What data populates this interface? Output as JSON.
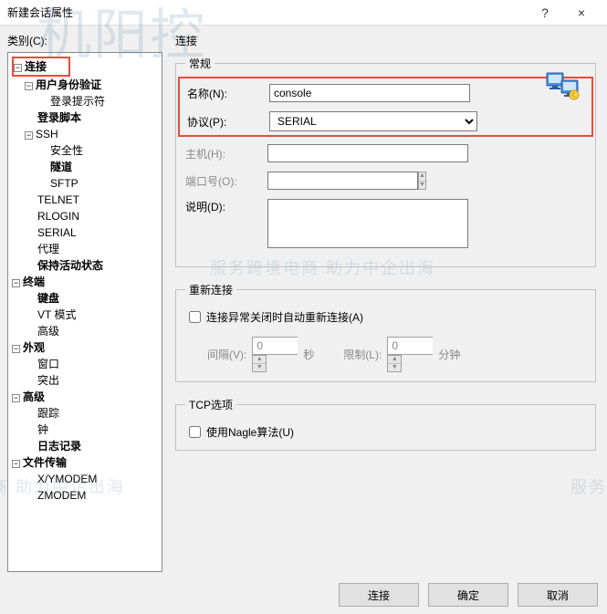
{
  "window": {
    "title": "新建会话属性",
    "help": "?",
    "close": "×"
  },
  "sidebar": {
    "label": "类别(C):",
    "tree": {
      "connection": "连接",
      "user_auth": "用户身份验证",
      "login_prompt": "登录提示符",
      "login_script": "登录脚本",
      "ssh": "SSH",
      "security": "安全性",
      "tunnel": "隧道",
      "sftp": "SFTP",
      "telnet": "TELNET",
      "rlogin": "RLOGIN",
      "serial": "SERIAL",
      "proxy": "代理",
      "keepalive": "保持活动状态",
      "terminal": "终端",
      "keyboard": "键盘",
      "vt": "VT 模式",
      "advanced_t": "高级",
      "appearance": "外观",
      "window": "窗口",
      "highlight": "突出",
      "advanced": "高级",
      "trace": "跟踪",
      "bell": "钟",
      "logging": "日志记录",
      "file_transfer": "文件传输",
      "xy": "X/YMODEM",
      "z": "ZMODEM"
    }
  },
  "main": {
    "title": "连接",
    "general": {
      "legend": "常规",
      "name_label": "名称(N):",
      "name_value": "console",
      "protocol_label": "协议(P):",
      "protocol_value": "SERIAL",
      "host_label": "主机(H):",
      "host_value": "",
      "port_label": "端口号(O):",
      "port_value": "",
      "desc_label": "说明(D):",
      "desc_value": ""
    },
    "reconnect": {
      "legend": "重新连接",
      "auto_label": "连接异常关闭时自动重新连接(A)",
      "interval_label": "间隔(V):",
      "interval_value": "0",
      "interval_unit": "秒",
      "limit_label": "限制(L):",
      "limit_value": "0",
      "limit_unit": "分钟"
    },
    "tcp": {
      "legend": "TCP选项",
      "nagle_label": "使用Nagle算法(U)"
    }
  },
  "footer": {
    "connect": "连接",
    "ok": "确定",
    "cancel": "取消"
  },
  "watermarks": {
    "w1": "机阳控",
    "w2": "服务跨境电商 助力中企出海",
    "w3": "电商 助力中企出海",
    "w4": "服务跨境"
  }
}
